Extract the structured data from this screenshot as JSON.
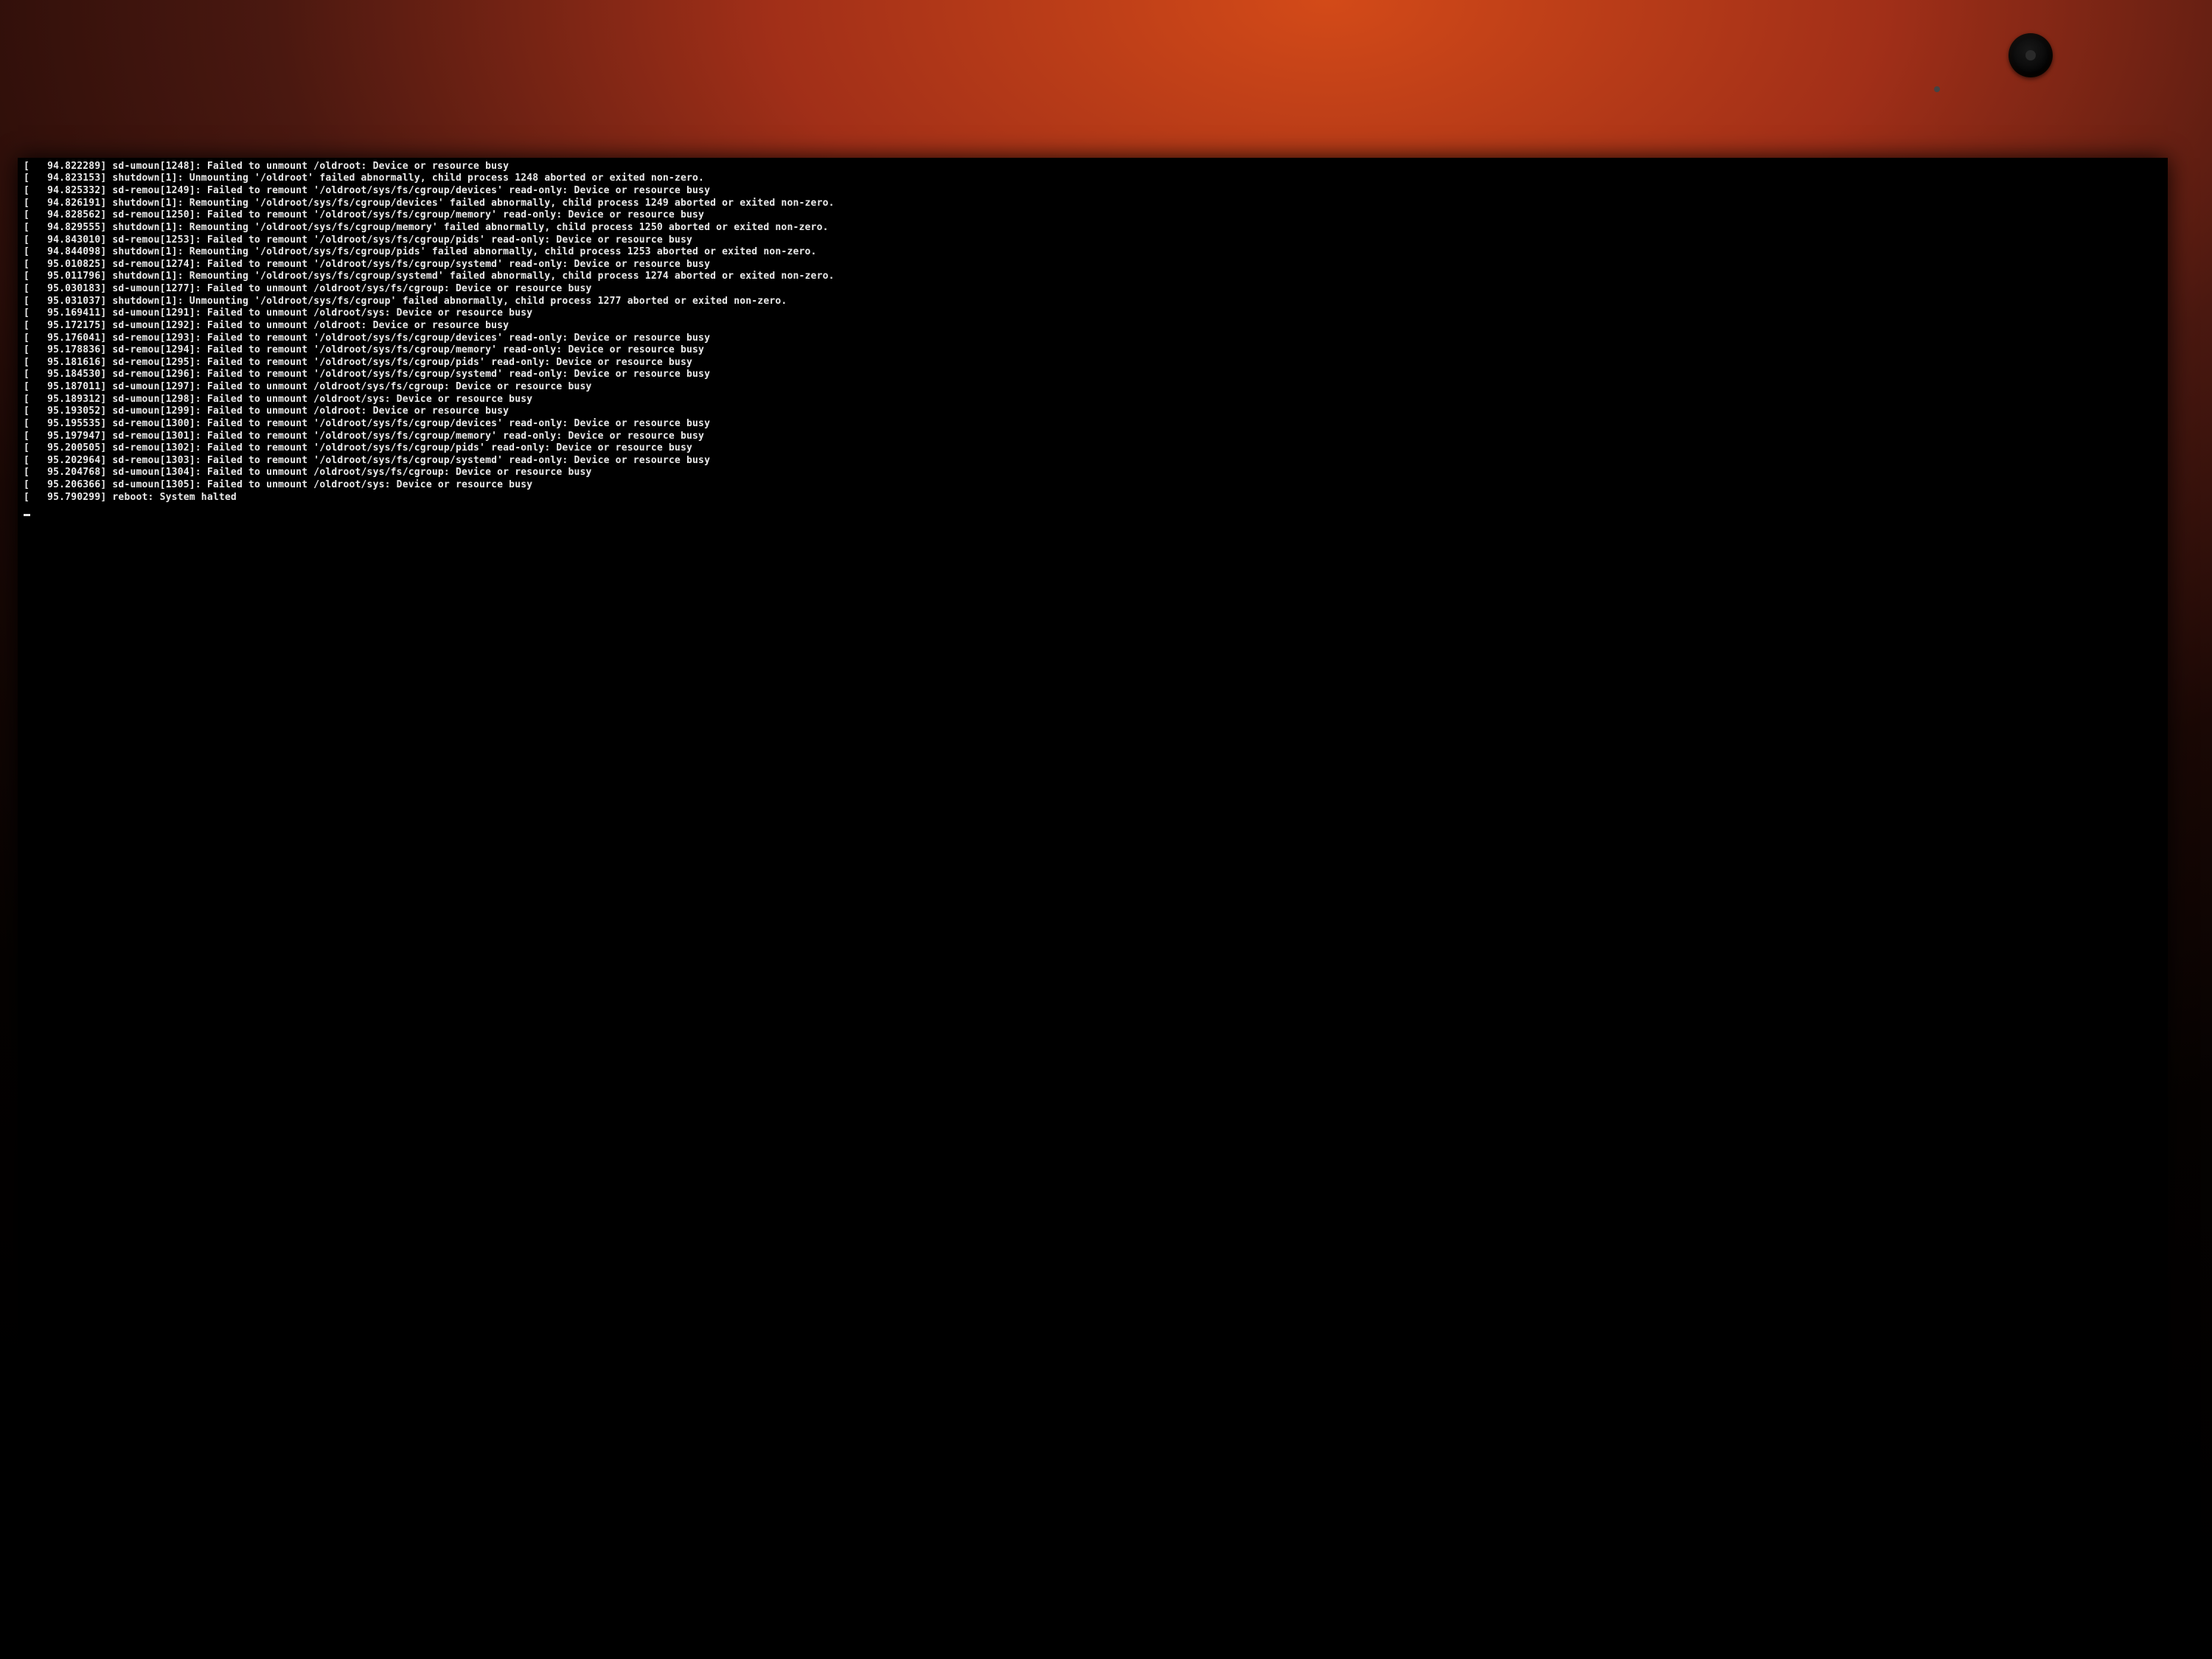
{
  "console": {
    "lines": [
      {
        "ts": "94.822289",
        "proc": "sd-umoun[1248]",
        "msg": "Failed to unmount /oldroot: Device or resource busy"
      },
      {
        "ts": "94.823153",
        "proc": "shutdown[1]",
        "msg": "Unmounting '/oldroot' failed abnormally, child process 1248 aborted or exited non-zero."
      },
      {
        "ts": "94.825332",
        "proc": "sd-remou[1249]",
        "msg": "Failed to remount '/oldroot/sys/fs/cgroup/devices' read-only: Device or resource busy"
      },
      {
        "ts": "94.826191",
        "proc": "shutdown[1]",
        "msg": "Remounting '/oldroot/sys/fs/cgroup/devices' failed abnormally, child process 1249 aborted or exited non-zero."
      },
      {
        "ts": "94.828562",
        "proc": "sd-remou[1250]",
        "msg": "Failed to remount '/oldroot/sys/fs/cgroup/memory' read-only: Device or resource busy"
      },
      {
        "ts": "94.829555",
        "proc": "shutdown[1]",
        "msg": "Remounting '/oldroot/sys/fs/cgroup/memory' failed abnormally, child process 1250 aborted or exited non-zero."
      },
      {
        "ts": "94.843010",
        "proc": "sd-remou[1253]",
        "msg": "Failed to remount '/oldroot/sys/fs/cgroup/pids' read-only: Device or resource busy"
      },
      {
        "ts": "94.844098",
        "proc": "shutdown[1]",
        "msg": "Remounting '/oldroot/sys/fs/cgroup/pids' failed abnormally, child process 1253 aborted or exited non-zero."
      },
      {
        "ts": "95.010825",
        "proc": "sd-remou[1274]",
        "msg": "Failed to remount '/oldroot/sys/fs/cgroup/systemd' read-only: Device or resource busy"
      },
      {
        "ts": "95.011796",
        "proc": "shutdown[1]",
        "msg": "Remounting '/oldroot/sys/fs/cgroup/systemd' failed abnormally, child process 1274 aborted or exited non-zero."
      },
      {
        "ts": "95.030183",
        "proc": "sd-umoun[1277]",
        "msg": "Failed to unmount /oldroot/sys/fs/cgroup: Device or resource busy"
      },
      {
        "ts": "95.031037",
        "proc": "shutdown[1]",
        "msg": "Unmounting '/oldroot/sys/fs/cgroup' failed abnormally, child process 1277 aborted or exited non-zero."
      },
      {
        "ts": "95.169411",
        "proc": "sd-umoun[1291]",
        "msg": "Failed to unmount /oldroot/sys: Device or resource busy"
      },
      {
        "ts": "95.172175",
        "proc": "sd-umoun[1292]",
        "msg": "Failed to unmount /oldroot: Device or resource busy"
      },
      {
        "ts": "95.176041",
        "proc": "sd-remou[1293]",
        "msg": "Failed to remount '/oldroot/sys/fs/cgroup/devices' read-only: Device or resource busy"
      },
      {
        "ts": "95.178836",
        "proc": "sd-remou[1294]",
        "msg": "Failed to remount '/oldroot/sys/fs/cgroup/memory' read-only: Device or resource busy"
      },
      {
        "ts": "95.181616",
        "proc": "sd-remou[1295]",
        "msg": "Failed to remount '/oldroot/sys/fs/cgroup/pids' read-only: Device or resource busy"
      },
      {
        "ts": "95.184530",
        "proc": "sd-remou[1296]",
        "msg": "Failed to remount '/oldroot/sys/fs/cgroup/systemd' read-only: Device or resource busy"
      },
      {
        "ts": "95.187011",
        "proc": "sd-umoun[1297]",
        "msg": "Failed to unmount /oldroot/sys/fs/cgroup: Device or resource busy"
      },
      {
        "ts": "95.189312",
        "proc": "sd-umoun[1298]",
        "msg": "Failed to unmount /oldroot/sys: Device or resource busy"
      },
      {
        "ts": "95.193052",
        "proc": "sd-umoun[1299]",
        "msg": "Failed to unmount /oldroot: Device or resource busy"
      },
      {
        "ts": "95.195535",
        "proc": "sd-remou[1300]",
        "msg": "Failed to remount '/oldroot/sys/fs/cgroup/devices' read-only: Device or resource busy"
      },
      {
        "ts": "95.197947",
        "proc": "sd-remou[1301]",
        "msg": "Failed to remount '/oldroot/sys/fs/cgroup/memory' read-only: Device or resource busy"
      },
      {
        "ts": "95.200505",
        "proc": "sd-remou[1302]",
        "msg": "Failed to remount '/oldroot/sys/fs/cgroup/pids' read-only: Device or resource busy"
      },
      {
        "ts": "95.202964",
        "proc": "sd-remou[1303]",
        "msg": "Failed to remount '/oldroot/sys/fs/cgroup/systemd' read-only: Device or resource busy"
      },
      {
        "ts": "95.204768",
        "proc": "sd-umoun[1304]",
        "msg": "Failed to unmount /oldroot/sys/fs/cgroup: Device or resource busy"
      },
      {
        "ts": "95.206366",
        "proc": "sd-umoun[1305]",
        "msg": "Failed to unmount /oldroot/sys: Device or resource busy"
      },
      {
        "ts": "95.790299",
        "proc": "reboot",
        "msg": "System halted"
      }
    ]
  }
}
